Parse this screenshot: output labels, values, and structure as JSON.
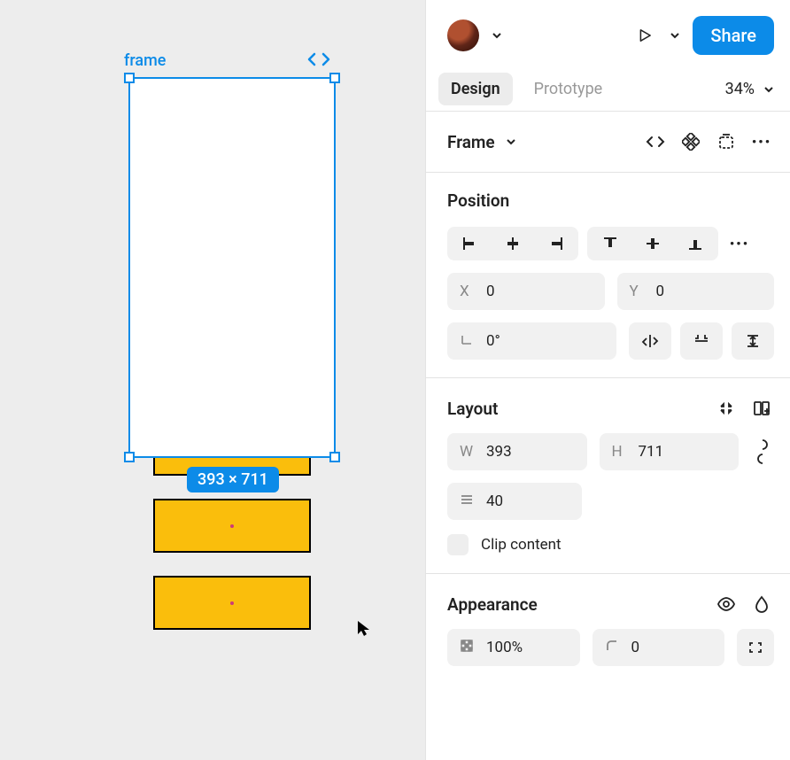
{
  "canvas": {
    "frame_label": "frame",
    "dimensions_badge": "393 × 711"
  },
  "panel": {
    "share_label": "Share",
    "tabs": {
      "design": "Design",
      "prototype": "Prototype"
    },
    "zoom_value": "34%",
    "frame_header": "Frame",
    "position": {
      "title": "Position",
      "x_label": "X",
      "x_value": "0",
      "y_label": "Y",
      "y_value": "0",
      "rotation_value": "0°"
    },
    "layout": {
      "title": "Layout",
      "w_label": "W",
      "w_value": "393",
      "h_label": "H",
      "h_value": "711",
      "gap_value": "40",
      "clip_label": "Clip content"
    },
    "appearance": {
      "title": "Appearance",
      "opacity_value": "100%",
      "radius_value": "0"
    }
  }
}
